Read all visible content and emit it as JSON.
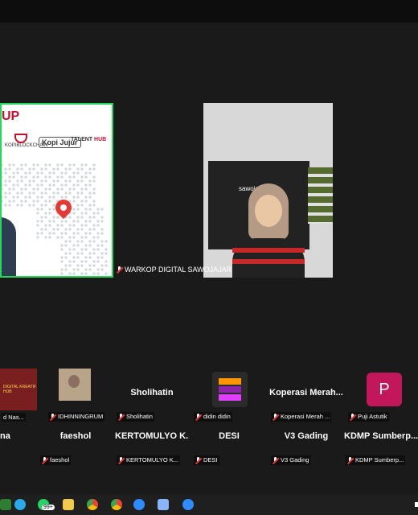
{
  "presenter": {
    "heading": "UP",
    "logos": {
      "kopi_blockchain": "KOPIBLOCKCHAIN",
      "kopi_jujur": "Kopi Jujur",
      "talent": "TALENT",
      "hub": "HUB"
    }
  },
  "warkop": {
    "name_tag": "WARKOP DIGITAL SAWOJAJAR",
    "backdrop_text": "sawoja"
  },
  "gallery": {
    "row1": [
      {
        "name": "",
        "sub": "d Nas..."
      },
      {
        "name": "",
        "sub": "IDHINNINGRUM"
      },
      {
        "name": "Sholihatin",
        "sub": "Sholihatin"
      },
      {
        "name": "",
        "sub": "didin didin"
      },
      {
        "name": "Koperasi  Merah...",
        "sub": "Koperasi Merah ..."
      },
      {
        "name": "P",
        "sub": "Puji Astutik"
      }
    ],
    "row2": [
      {
        "name": "na",
        "sub": ""
      },
      {
        "name": "faeshol",
        "sub": "faeshol"
      },
      {
        "name": "KERTOMULYO  K...",
        "sub": "KERTOMULYO  K..."
      },
      {
        "name": "DESI",
        "sub": "DESI"
      },
      {
        "name": "V3 Gading",
        "sub": "V3 Gading"
      },
      {
        "name": "KDMP  Sumberp...",
        "sub": "KDMP Sumberp..."
      }
    ]
  },
  "taskbar": {
    "badge": "99+"
  },
  "colors": {
    "accent_green": "#23d959",
    "brand_red": "#c8102e",
    "avatar_p": "#c2185b"
  }
}
